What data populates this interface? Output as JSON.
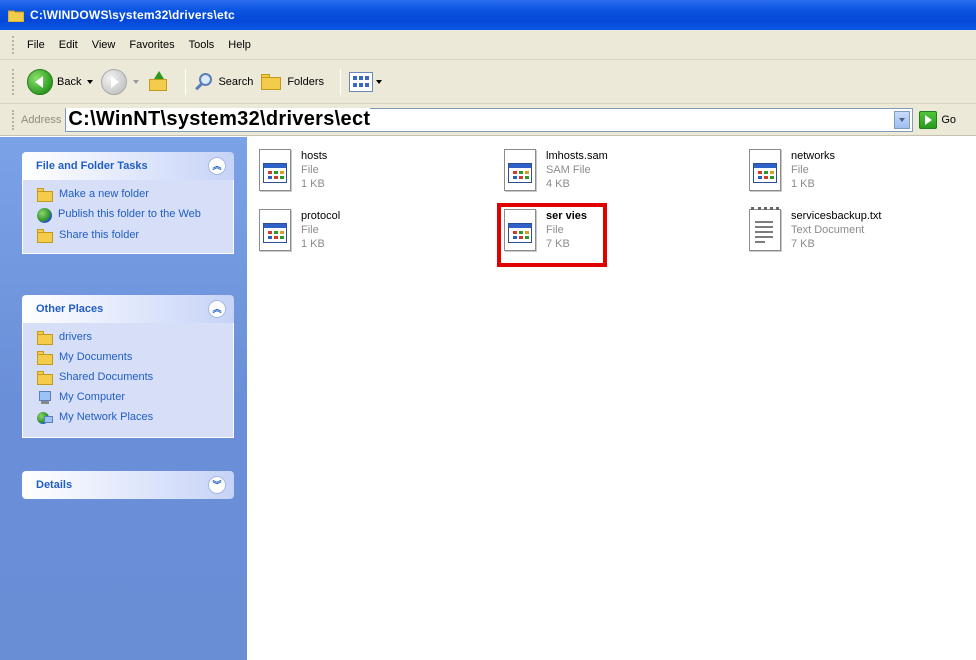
{
  "window": {
    "title": "C:\\WINDOWS\\system32\\drivers\\etc"
  },
  "menu": [
    "File",
    "Edit",
    "View",
    "Favorites",
    "Tools",
    "Help"
  ],
  "toolbar": {
    "back": "Back",
    "search": "Search",
    "folders": "Folders"
  },
  "address": {
    "label": "Address",
    "value": "C:\\WinNT\\system32\\drivers\\ect",
    "go": "Go"
  },
  "left_pane": {
    "file_tasks": {
      "title": "File and Folder Tasks",
      "items": [
        "Make a new folder",
        "Publish this folder to the Web",
        "Share this folder"
      ]
    },
    "other_places": {
      "title": "Other Places",
      "items": [
        "drivers",
        "My Documents",
        "Shared Documents",
        "My Computer",
        "My Network Places"
      ]
    },
    "details": {
      "title": "Details"
    }
  },
  "files": [
    {
      "name": "hosts",
      "type": "File",
      "size": "1 KB",
      "icon": "system-file-icon"
    },
    {
      "name": "lmhosts.sam",
      "type": "SAM File",
      "size": "4 KB",
      "icon": "system-file-icon"
    },
    {
      "name": "networks",
      "type": "File",
      "size": "1 KB",
      "icon": "system-file-icon"
    },
    {
      "name": "protocol",
      "type": "File",
      "size": "1 KB",
      "icon": "system-file-icon"
    },
    {
      "name": "ser vies",
      "type": "File",
      "size": "7 KB",
      "icon": "system-file-icon",
      "highlighted": true
    },
    {
      "name": "servicesbackup.txt",
      "type": "Text Document",
      "size": "7 KB",
      "icon": "text-document-icon"
    }
  ],
  "colors": {
    "highlight": "#e00000",
    "task_link": "#215dc6",
    "titlebar": "#0a54e0"
  }
}
